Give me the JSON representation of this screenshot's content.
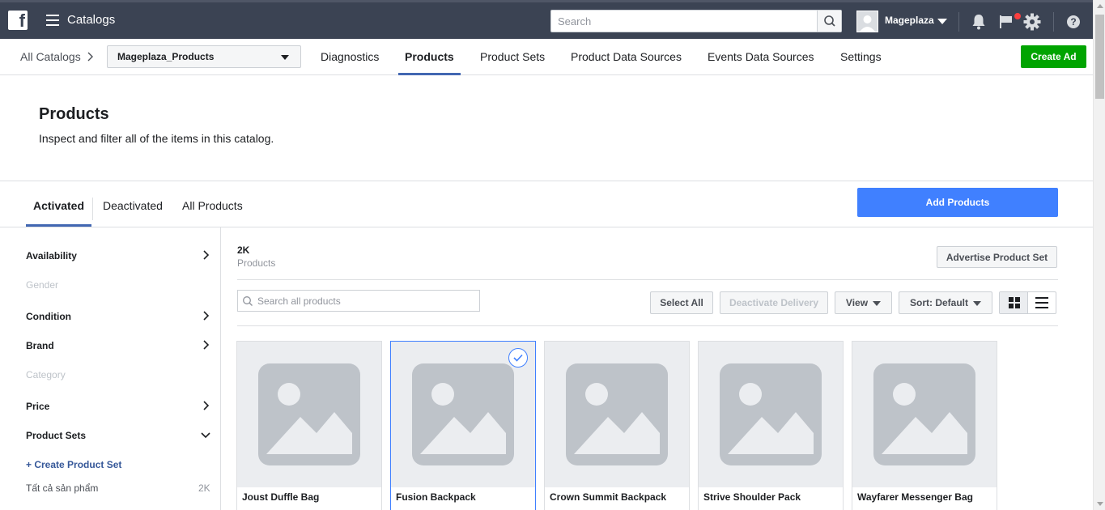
{
  "topbar": {
    "app_title": "Catalogs",
    "search_placeholder": "Search",
    "user_name": "Mageplaza",
    "icons": [
      "facebook-logo-icon",
      "menu-icon",
      "search-icon",
      "avatar",
      "chevron-down-icon",
      "bell-icon",
      "flag-icon",
      "gear-icon",
      "help-icon"
    ]
  },
  "subnav": {
    "all_catalogs": "All Catalogs",
    "catalog_name": "Mageplaza_Products",
    "tabs": [
      "Diagnostics",
      "Products",
      "Product Sets",
      "Product Data Sources",
      "Events Data Sources",
      "Settings"
    ],
    "active_tab": "Products",
    "create_ad": "Create Ad"
  },
  "header": {
    "title": "Products",
    "subtitle": "Inspect and filter all of the items in this catalog."
  },
  "status_tabs": {
    "items": [
      "Activated",
      "Deactivated",
      "All Products"
    ],
    "active": "Activated",
    "add_products": "Add Products"
  },
  "sidebar": {
    "filters": [
      {
        "label": "Availability",
        "enabled": true,
        "chevron": "right"
      },
      {
        "label": "Gender",
        "enabled": false
      },
      {
        "label": "Condition",
        "enabled": true,
        "chevron": "right"
      },
      {
        "label": "Brand",
        "enabled": true,
        "chevron": "right"
      },
      {
        "label": "Category",
        "enabled": false
      },
      {
        "label": "Price",
        "enabled": true,
        "chevron": "right"
      },
      {
        "label": "Product Sets",
        "enabled": true,
        "chevron": "down"
      }
    ],
    "create_set": "+ Create Product Set",
    "product_set": {
      "name": "Tất cả sản phẩm",
      "count": "2K"
    }
  },
  "main": {
    "count": "2K",
    "count_label": "Products",
    "advertise": "Advertise Product Set",
    "search_placeholder": "Search all products",
    "select_all": "Select All",
    "deactivate": "Deactivate Delivery",
    "view": "View",
    "sort": "Sort: Default",
    "products": [
      {
        "name": "Joust Duffle Bag",
        "selected": false
      },
      {
        "name": "Fusion Backpack",
        "selected": true
      },
      {
        "name": "Crown Summit Backpack",
        "selected": false
      },
      {
        "name": "Strive Shoulder Pack",
        "selected": false
      },
      {
        "name": "Wayfarer Messenger Bag",
        "selected": false
      }
    ]
  },
  "colors": {
    "topbar": "#3b4353",
    "accent_blue": "#4080ff",
    "tab_underline": "#4267b2",
    "create_ad_green": "#00a400",
    "notification_red": "#fa3e3e"
  }
}
